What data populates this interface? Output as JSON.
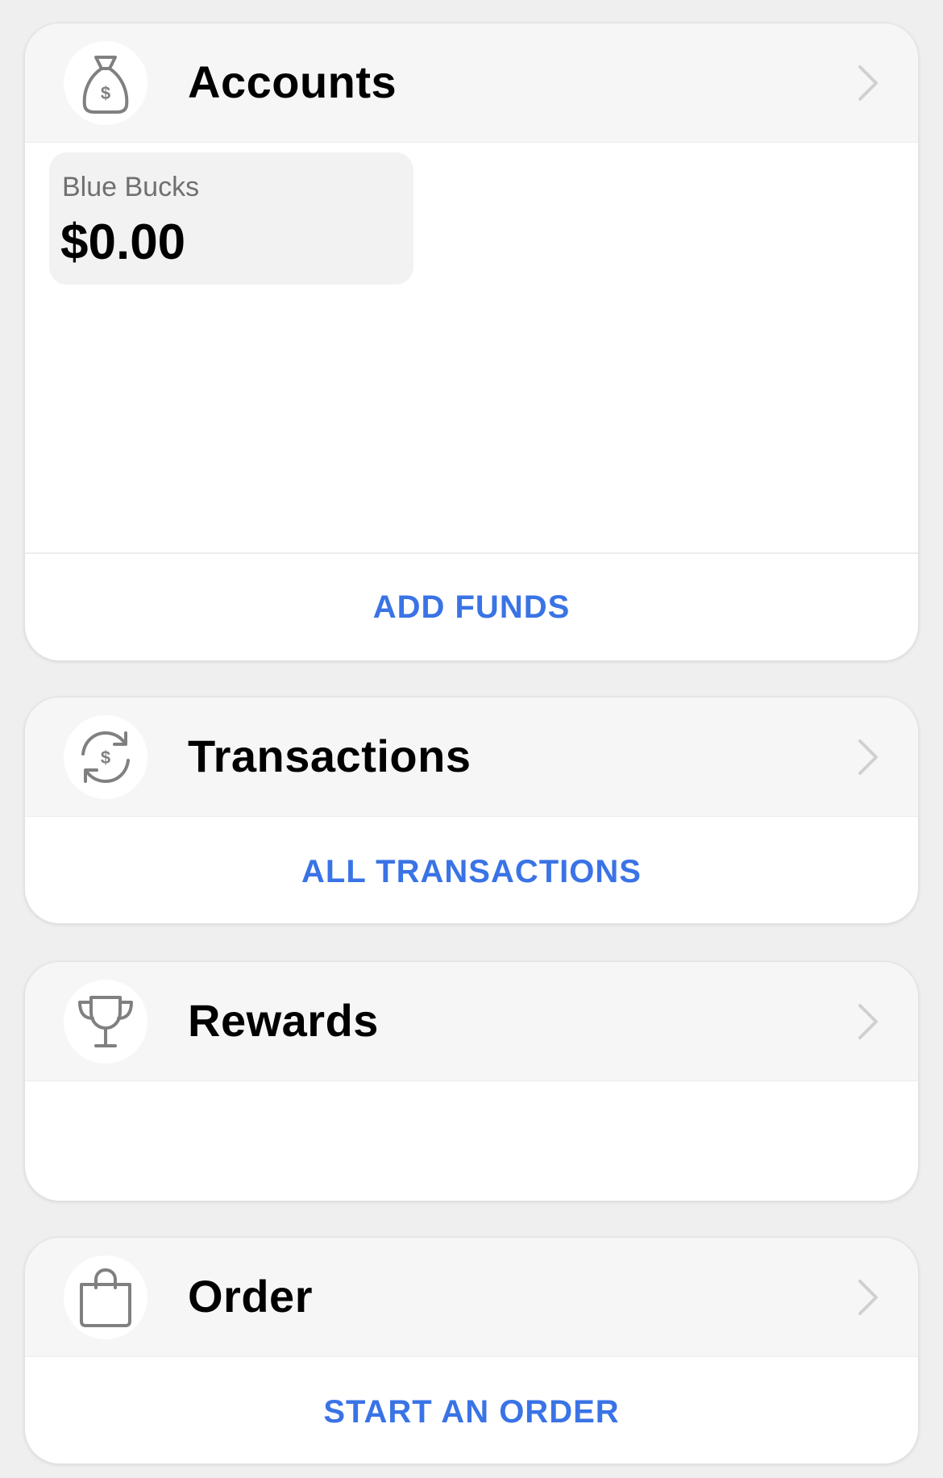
{
  "accounts": {
    "title": "Accounts",
    "icon": "money-bag-icon",
    "balances": [
      {
        "name": "Blue Bucks",
        "amount": "$0.00"
      }
    ],
    "action_label": "ADD FUNDS"
  },
  "transactions": {
    "title": "Transactions",
    "icon": "refresh-dollar-icon",
    "action_label": "ALL TRANSACTIONS"
  },
  "rewards": {
    "title": "Rewards",
    "icon": "trophy-icon"
  },
  "order": {
    "title": "Order",
    "icon": "shopping-bag-icon",
    "action_label": "START AN ORDER"
  },
  "colors": {
    "accent": "#3a73e6",
    "header_bg": "#f6f6f6",
    "icon_gray": "#808080",
    "chevron_gray": "#d0d0d0"
  }
}
